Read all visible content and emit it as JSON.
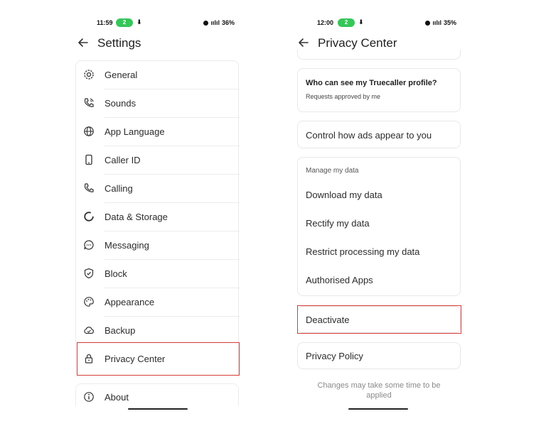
{
  "left": {
    "status": {
      "time": "11:59",
      "pill": "2",
      "battery": "36%"
    },
    "title": "Settings",
    "items": [
      {
        "label": "General",
        "icon": "gear-icon"
      },
      {
        "label": "Sounds",
        "icon": "phone-sound-icon"
      },
      {
        "label": "App Language",
        "icon": "globe-icon"
      },
      {
        "label": "Caller ID",
        "icon": "phone-device-icon"
      },
      {
        "label": "Calling",
        "icon": "phone-icon"
      },
      {
        "label": "Data & Storage",
        "icon": "pie-chart-icon"
      },
      {
        "label": "Messaging",
        "icon": "message-icon"
      },
      {
        "label": "Block",
        "icon": "shield-icon"
      },
      {
        "label": "Appearance",
        "icon": "palette-icon"
      },
      {
        "label": "Backup",
        "icon": "cloud-icon"
      },
      {
        "label": "Privacy Center",
        "icon": "lock-icon"
      }
    ],
    "about": {
      "label": "About",
      "icon": "info-icon"
    }
  },
  "right": {
    "status": {
      "time": "12:00",
      "pill": "2",
      "battery": "35%"
    },
    "title": "Privacy Center",
    "profile_card": {
      "title": "Who can see my Truecaller profile?",
      "subtitle": "Requests approved by me"
    },
    "ads_label": "Control how ads appear to you",
    "manage": {
      "header": "Manage my data",
      "items": [
        "Download my data",
        "Rectify my data",
        "Restrict processing my data",
        "Authorised Apps"
      ]
    },
    "deactivate_label": "Deactivate",
    "policy_label": "Privacy Policy",
    "footnote": "Changes may take some time to be applied"
  },
  "colors": {
    "highlight": "#d93a3a",
    "pill": "#36c65a"
  }
}
